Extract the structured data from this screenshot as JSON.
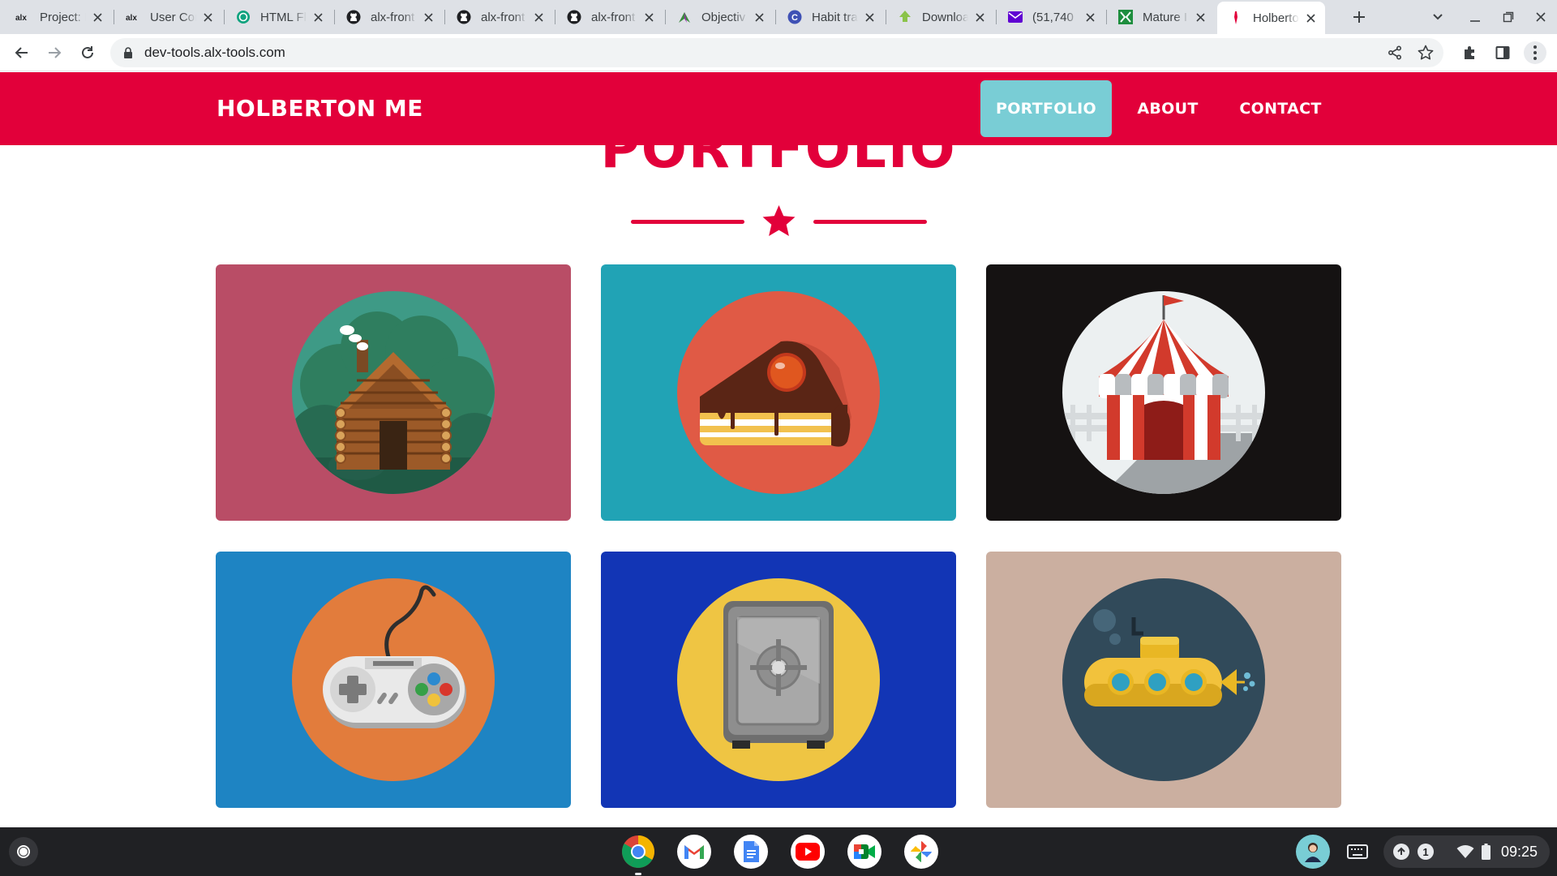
{
  "browser": {
    "tabs": [
      {
        "title": "Project: I",
        "favicon": "alx-logo"
      },
      {
        "title": "User Con",
        "favicon": "alx-logo"
      },
      {
        "title": "HTML Fl",
        "favicon": "chatgpt-icon"
      },
      {
        "title": "alx-front",
        "favicon": "github-icon"
      },
      {
        "title": "alx-front",
        "favicon": "github-icon"
      },
      {
        "title": "alx-front",
        "favicon": "github-icon"
      },
      {
        "title": "Objectiv",
        "favicon": "feather-icon"
      },
      {
        "title": "Habit tra",
        "favicon": "c-icon"
      },
      {
        "title": "Downloa",
        "favicon": "download-icon"
      },
      {
        "title": "(51,740",
        "favicon": "mail-icon"
      },
      {
        "title": "Mature I",
        "favicon": "green-logo"
      },
      {
        "title": "Holberto",
        "favicon": "holberton-icon",
        "active": true
      }
    ],
    "alx_favicon_text": "alx",
    "url": "dev-tools.alx-tools.com"
  },
  "site": {
    "brand": "HOLBERTON ME",
    "nav": [
      {
        "label": "PORTFOLIO",
        "active": true
      },
      {
        "label": "ABOUT"
      },
      {
        "label": "CONTACT"
      }
    ],
    "section_title": "PORTFOLIO",
    "portfolio": [
      {
        "name": "cabin",
        "bg": "#b94d66",
        "circle": "#3e9a86"
      },
      {
        "name": "cake",
        "bg": "#21a3b5",
        "circle": "#e05a45"
      },
      {
        "name": "circus",
        "bg": "#151212",
        "circle": "#ecf0f1"
      },
      {
        "name": "game-controller",
        "bg": "#1e84c3",
        "circle": "#e27c3c"
      },
      {
        "name": "safe",
        "bg": "#1235b5",
        "circle": "#efc543"
      },
      {
        "name": "submarine",
        "bg": "#cbafa0",
        "circle": "#314a5a"
      }
    ],
    "colors": {
      "primary": "#e2003a",
      "active_nav": "#79cdd5"
    }
  },
  "shelf": {
    "apps": [
      "chrome-icon",
      "gmail-icon",
      "docs-icon",
      "youtube-icon",
      "meet-icon",
      "photos-icon"
    ],
    "notification_count": "1",
    "time": "09:25"
  }
}
